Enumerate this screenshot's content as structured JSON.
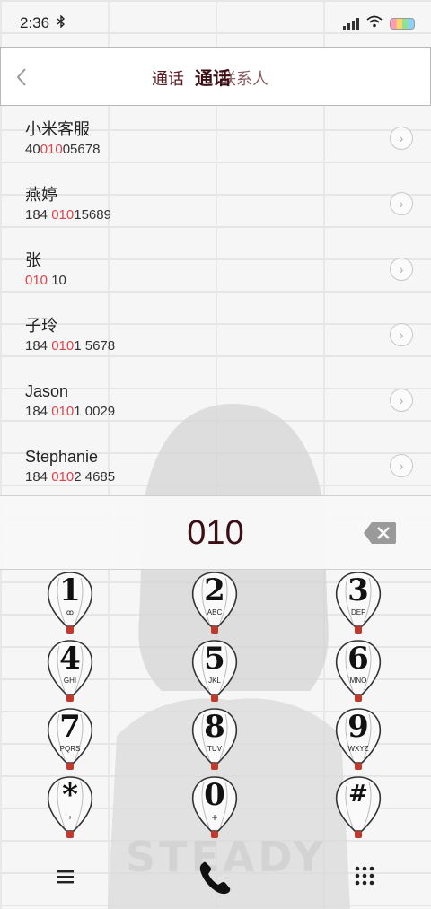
{
  "status_bar": {
    "time": "2:36",
    "bluetooth_icon": "bluetooth-icon",
    "signal_icon": "signal-icon",
    "wifi_icon": "wifi-icon",
    "battery_icon": "battery-icon"
  },
  "header": {
    "back_icon": "chevron-left-icon",
    "tab_calls": "通话",
    "tab_active": "通话",
    "tab_contacts": "联系人"
  },
  "contacts": [
    {
      "name": "小米客服",
      "number_pre": "40",
      "number_match": "010",
      "number_post": "05678"
    },
    {
      "name": "燕婷",
      "number_pre": "184 ",
      "number_match": "010",
      "number_post": "15689"
    },
    {
      "name": "张",
      "number_pre": "",
      "number_match": "010",
      "number_post": " 10"
    },
    {
      "name": "子玲",
      "number_pre": "184 ",
      "number_match": "010",
      "number_post": "1 5678"
    },
    {
      "name": "Jason",
      "number_pre": "184 ",
      "number_match": "010",
      "number_post": "1 0029"
    },
    {
      "name": "Stephanie",
      "number_pre": "184 ",
      "number_match": "010",
      "number_post": "2 4685"
    }
  ],
  "dialer": {
    "entered_number": "010",
    "delete_icon": "backspace-icon",
    "keys": [
      {
        "digit": "1",
        "letters": "ꝏ"
      },
      {
        "digit": "2",
        "letters": "ABC"
      },
      {
        "digit": "3",
        "letters": "DEF"
      },
      {
        "digit": "4",
        "letters": "GHI"
      },
      {
        "digit": "5",
        "letters": "JKL"
      },
      {
        "digit": "6",
        "letters": "MNO"
      },
      {
        "digit": "7",
        "letters": "PQRS"
      },
      {
        "digit": "8",
        "letters": "TUV"
      },
      {
        "digit": "9",
        "letters": "WXYZ"
      },
      {
        "digit": "*",
        "letters": ","
      },
      {
        "digit": "0",
        "letters": "+"
      },
      {
        "digit": "#",
        "letters": ""
      }
    ]
  },
  "bottom_bar": {
    "menu_icon": "menu-icon",
    "call_icon": "phone-icon",
    "keypad_icon": "keypad-icon"
  },
  "wallpaper": {
    "text": "STEADY"
  },
  "colors": {
    "accent": "#e0424a",
    "title": "#3a0f15"
  }
}
